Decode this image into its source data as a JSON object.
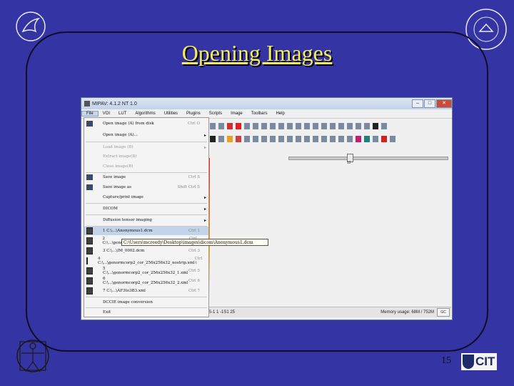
{
  "slide": {
    "title": "Opening Images",
    "page_number": "15",
    "cit_logo_text": "CIT"
  },
  "window": {
    "title": "MIPAV: 4.1.2  NT 1.0",
    "menus": [
      "File",
      "VOI",
      "LUT",
      "Algorithms",
      "Utilities",
      "Plugins",
      "Scripts",
      "Image",
      "Toolbars",
      "Help"
    ],
    "slider_value": "12",
    "status_left": "S-1 1 -1S1 25",
    "memory": "Memory usage: 68M / 752M",
    "gc_label": "GC"
  },
  "file_menu": {
    "items": [
      {
        "label": "Open image (A) from disk",
        "shortcut": "Ctrl O",
        "icon": "open-folder-icon"
      },
      {
        "label": "Open image (A)...",
        "shortcut": "",
        "submenu": true
      },
      {
        "label": "Load image (B)",
        "shortcut": "",
        "submenu": true,
        "disabled": true
      },
      {
        "label": "Extract image(B)",
        "disabled": true
      },
      {
        "label": "Close image(B)",
        "disabled": true
      },
      {
        "label": "Save image",
        "shortcut": "Ctrl S",
        "icon": "save-icon"
      },
      {
        "label": "Save image as",
        "shortcut": "Shift Ctrl S",
        "icon": "save-as-icon"
      },
      {
        "label": "Capture/print image",
        "submenu": true
      },
      {
        "label": "DICOM",
        "submenu": true
      },
      {
        "label": "Diffusion tensor imaging",
        "submenu": true
      },
      {
        "label": "1 C:\\...\\Anonymous1.dcm",
        "shortcut": "Ctrl 1",
        "highlighted": true
      },
      {
        "label": "2 C:\\...\\genormcorp2_cor_256x256x32_ss.xml",
        "shortcut": "Ctrl 2"
      },
      {
        "label": "3 C:\\...\\IM_0002.dcm",
        "shortcut": "Ctrl 3"
      },
      {
        "label": "4 C:\\...\\genormcorp2_cor_256x256x32_nostrip.xml",
        "shortcut": "Ctrl 4"
      },
      {
        "label": "5 C:\\...\\genormcorp2_cor_256x256x32_1.xml",
        "shortcut": "Ctrl 5"
      },
      {
        "label": "6 C:\\...\\genormcorp2_cor_256x256x32_2.xml",
        "shortcut": "Ctrl 6"
      },
      {
        "label": "7 C:\\...\\AF3to3B3.xml",
        "shortcut": "Ctrl 7"
      },
      {
        "label": "DCCIE image conversion"
      },
      {
        "label": "Exit"
      }
    ],
    "tooltip": "C:\\Users\\mcreedy\\Desktop\\images\\dicom\\Anonymous1.dcm"
  }
}
